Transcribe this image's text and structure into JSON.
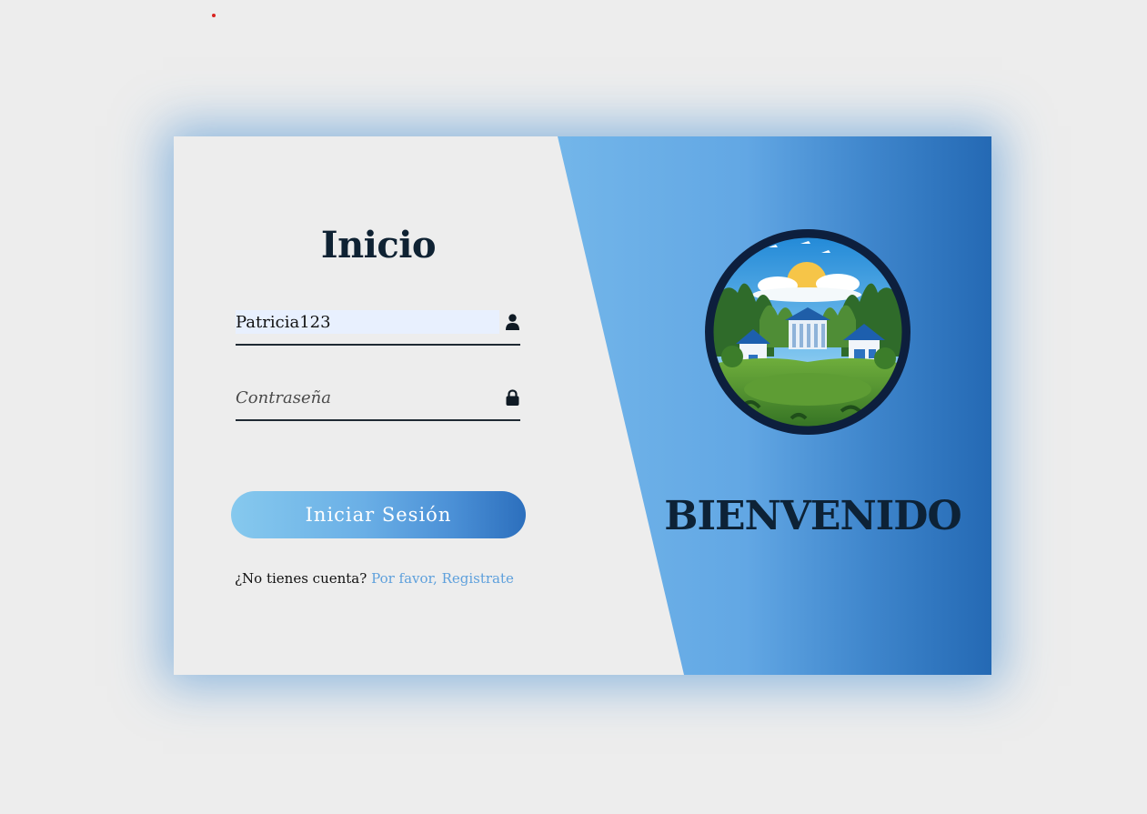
{
  "login": {
    "title": "Inicio",
    "username": {
      "value": "Patricia123",
      "icon": "user-icon"
    },
    "password": {
      "placeholder": "Contraseña",
      "icon": "lock-icon"
    },
    "submit_label": "Iniciar Sesión",
    "no_account_text": "¿No tienes cuenta?",
    "register_link_text": "Por favor, Registrate"
  },
  "welcome_panel": {
    "logo": "campus-landscape-logo",
    "welcome_text": "BIENVENIDO"
  },
  "colors": {
    "background": "#ededed",
    "accent_light": "#86c6ee",
    "accent_dark": "#2469b4",
    "text_dark": "#0f2233",
    "link": "#5ea0dc"
  }
}
